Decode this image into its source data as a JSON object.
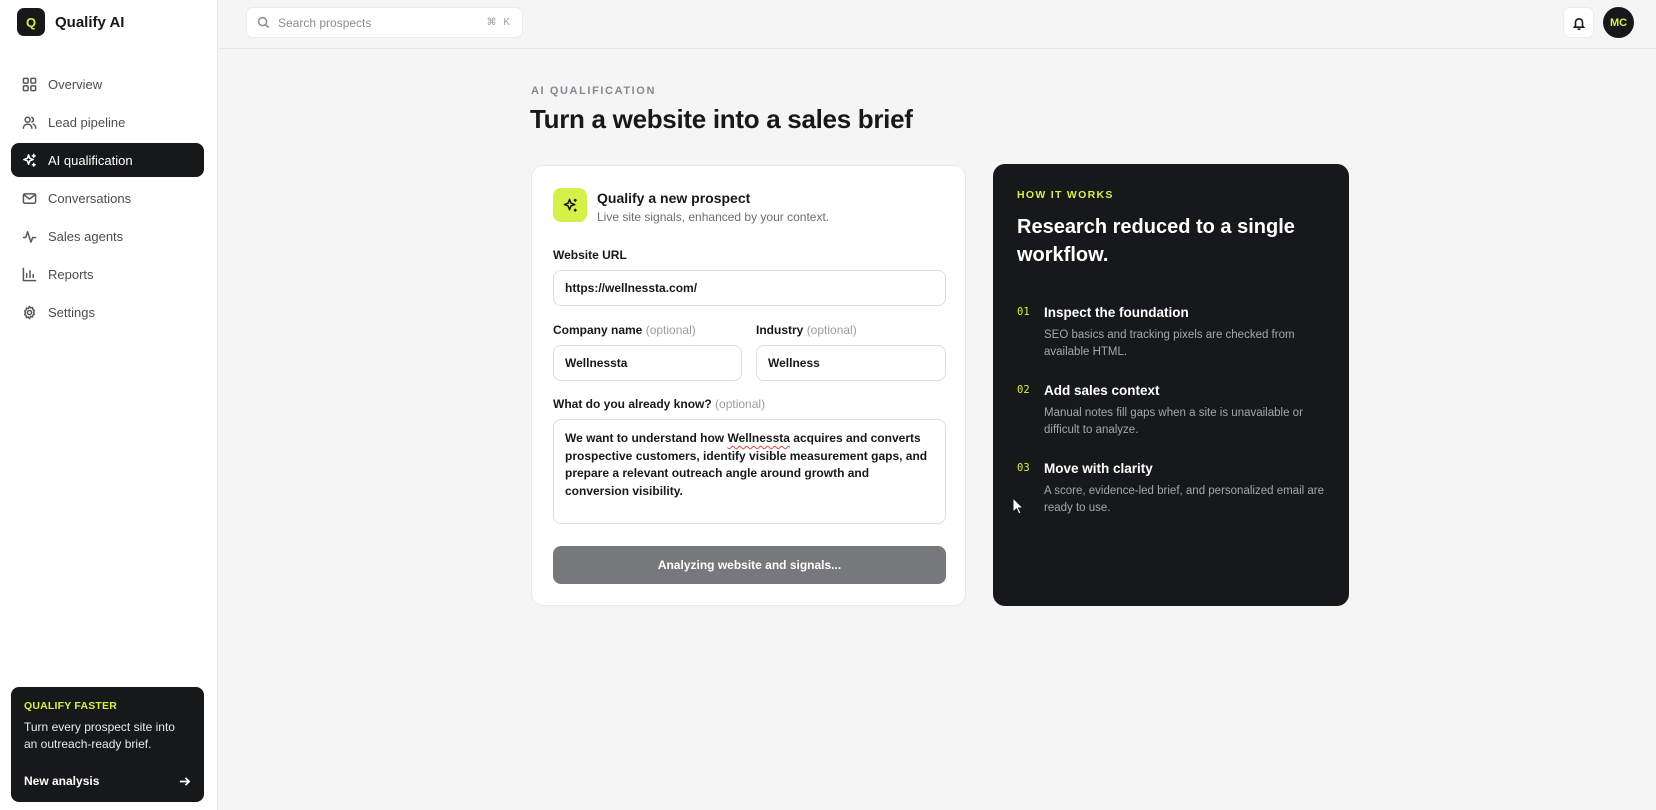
{
  "brand": {
    "logo_letter": "Q",
    "name": "Qualify AI"
  },
  "sidebar": {
    "items": [
      {
        "label": "Overview",
        "icon": "grid-icon"
      },
      {
        "label": "Lead pipeline",
        "icon": "users-icon"
      },
      {
        "label": "AI qualification",
        "icon": "sparkle-icon",
        "active": true
      },
      {
        "label": "Conversations",
        "icon": "mail-icon"
      },
      {
        "label": "Sales agents",
        "icon": "activity-icon"
      },
      {
        "label": "Reports",
        "icon": "bar-chart-icon"
      },
      {
        "label": "Settings",
        "icon": "gear-icon"
      }
    ],
    "promo": {
      "eyebrow": "QUALIFY FASTER",
      "text": "Turn every prospect site into an outreach-ready brief.",
      "cta": "New analysis"
    }
  },
  "topbar": {
    "search_placeholder": "Search prospects",
    "shortcut": "⌘ K",
    "avatar_initials": "MC"
  },
  "main": {
    "eyebrow": "AI QUALIFICATION",
    "title": "Turn a website into a sales brief"
  },
  "form": {
    "title": "Qualify a new prospect",
    "subtitle": "Live site signals, enhanced by your context.",
    "url_label": "Website URL",
    "url_value": "https://wellnessta.com/",
    "company_label": "Company name",
    "company_value": "Wellnessta",
    "industry_label": "Industry",
    "industry_value": "Wellness",
    "optional": "(optional)",
    "notes_label": "What do you already know?",
    "notes_before": "We want to understand how ",
    "notes_flagged": "Wellnessta",
    "notes_after": " acquires and converts prospective customers, identify visible measurement gaps, and prepare a relevant outreach angle around growth and conversion visibility.",
    "submit_label": "Analyzing website and signals..."
  },
  "how": {
    "eyebrow": "HOW IT WORKS",
    "title": "Research reduced to a single workflow.",
    "steps": [
      {
        "num": "01",
        "title": "Inspect the foundation",
        "text": "SEO basics and tracking pixels are checked from available HTML."
      },
      {
        "num": "02",
        "title": "Add sales context",
        "text": "Manual notes fill gaps when a site is unavailable or difficult to analyze."
      },
      {
        "num": "03",
        "title": "Move with clarity",
        "text": "A score, evidence-led brief, and personalized email are ready to use."
      }
    ]
  },
  "colors": {
    "accent": "#d6f04a",
    "dark": "#17181a",
    "background": "#f4f5f4"
  }
}
